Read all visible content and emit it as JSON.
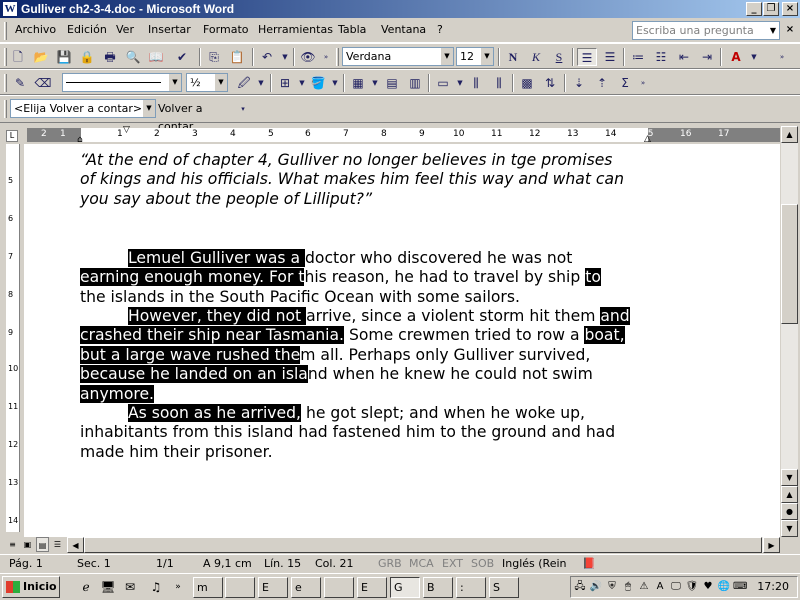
{
  "window": {
    "title": "Gulliver ch2-3-4.doc - Microsoft Word",
    "app_icon": "W"
  },
  "menu": {
    "items": [
      "Archivo",
      "Edición",
      "Ver",
      "Insertar",
      "Formato",
      "Herramientas",
      "Tabla",
      "Ventana",
      "?"
    ],
    "ask_placeholder": "Escriba una pregunta"
  },
  "format_toolbar": {
    "font": "Verdana",
    "size": "12"
  },
  "drawing_toolbar": {
    "zoom_fraction": "½"
  },
  "reviewing_toolbar": {
    "combo": "<Elija Volver a contar>",
    "button": "Volver a contar"
  },
  "ruler": {
    "light_numbers": [
      "1",
      "2"
    ],
    "numbers": [
      "1",
      "2",
      "3",
      "4",
      "5",
      "6",
      "7",
      "8",
      "9",
      "10",
      "11",
      "12",
      "13",
      "14",
      "15",
      "16",
      "17"
    ],
    "vertical_numbers": [
      "5",
      "6",
      "7",
      "8",
      "9",
      "10",
      "11",
      "12",
      "13",
      "14"
    ]
  },
  "document": {
    "quote_lines": [
      "“At the end of chapter 4, Gulliver no longer believes in tge promises",
      "of kings and his officials. What makes him feel this way and what can",
      "you say about the people of Lilliput?”"
    ],
    "p1": {
      "l1_hl": "Lemuel Gulliver was a ",
      "l1_rest": "doctor who discovered he was not",
      "l2_hl_a": "earning enough money. For t",
      "l2_rest": "his reason, he had to travel by ship ",
      "l2_hl_b": "to",
      "l3": "the islands in the South Pacific Ocean with some sailors."
    },
    "p2": {
      "l1_hl_a": "However, they did not ",
      "l1_mid": "arrive, since a violent storm hit them ",
      "l1_hl_b": "and",
      "l2_hl_a": "crashed their ship near Tasmania.",
      "l2_mid": " Some crewmen tried to row a ",
      "l2_hl_b": "boat,",
      "l3_hl": "but a large wave rushed the",
      "l3_rest": "m all. Perhaps only Gulliver survived,",
      "l4_hl": "because he landed on an isla",
      "l4_rest": "nd when he knew he could not swim",
      "l5_hl": "anymore."
    },
    "p3": {
      "l1_hl": "As soon as he arrived,",
      "l1_rest": " he got slept; and when he woke up,",
      "l2": "inhabitants from this island had fastened him to the ground and had",
      "l3": "made him their prisoner."
    }
  },
  "status": {
    "page": "Pág. 1",
    "section": "Sec. 1",
    "pages": "1/1",
    "at": "A 9,1 cm",
    "line": "Lín. 15",
    "col": "Col. 21",
    "grb": "GRB",
    "mca": "MCA",
    "ext": "EXT",
    "sob": "SOB",
    "language": "Inglés (Rein"
  },
  "taskbar": {
    "start": "Inicio",
    "tasks": [
      "m",
      "",
      "E",
      "e",
      "",
      "E",
      "G",
      "B",
      ":",
      "S"
    ],
    "clock": "17:20"
  }
}
